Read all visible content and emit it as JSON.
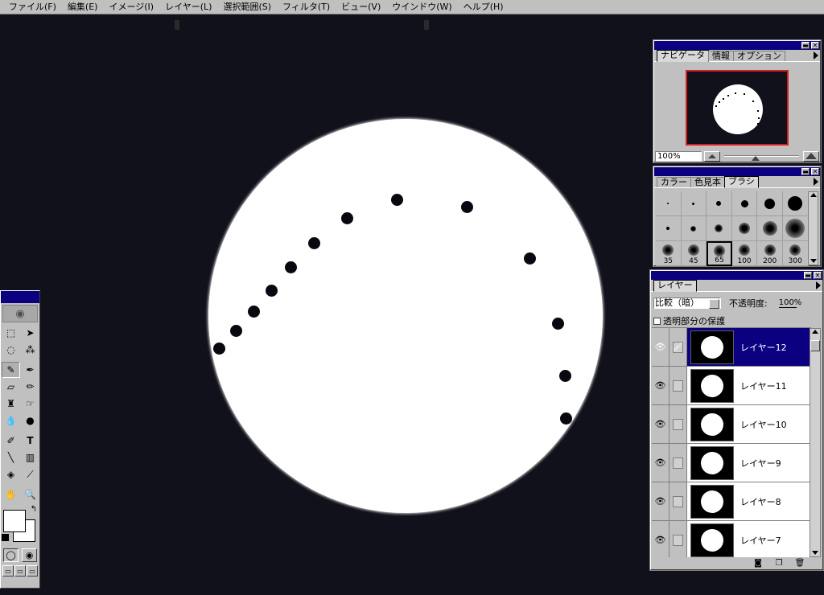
{
  "menubar": {
    "items": [
      "ファイル(F)",
      "編集(E)",
      "イメージ(I)",
      "レイヤー(L)",
      "選択範囲(S)",
      "フィルタ(T)",
      "ビュー(V)",
      "ウインドウ(W)",
      "ヘルプ(H)"
    ]
  },
  "canvas": {
    "background": "#11111c",
    "moon_color": "#ffffff"
  },
  "navigator": {
    "tabs": [
      "ナビゲータ",
      "情報",
      "オプション"
    ],
    "zoom": "100%"
  },
  "brushes": {
    "tabs": [
      "カラー",
      "色見本",
      "ブラシ"
    ],
    "sizes": [
      "35",
      "45",
      "65",
      "100",
      "200",
      "300"
    ],
    "selected": "65"
  },
  "layers": {
    "tab": "レイヤー",
    "blend_mode": "比較（暗）",
    "opacity_label": "不透明度:",
    "opacity_value": "100%",
    "preserve_label": "透明部分の保護",
    "items": [
      {
        "name": "レイヤー12",
        "active": true
      },
      {
        "name": "レイヤー11",
        "active": false
      },
      {
        "name": "レイヤー10",
        "active": false
      },
      {
        "name": "レイヤー9",
        "active": false
      },
      {
        "name": "レイヤー8",
        "active": false
      },
      {
        "name": "レイヤー7",
        "active": false
      }
    ]
  },
  "toolbox": {
    "tools": [
      "marquee-tool",
      "move-tool",
      "lasso-tool",
      "magic-wand-tool",
      "airbrush-tool",
      "paintbrush-tool",
      "eraser-tool",
      "pencil-tool",
      "rubber-stamp-tool",
      "smudge-tool",
      "blur-tool",
      "dodge-tool",
      "pen-tool",
      "type-tool",
      "line-tool",
      "gradient-tool",
      "paint-bucket-tool",
      "eyedropper-tool",
      "hand-tool",
      "zoom-tool"
    ]
  }
}
